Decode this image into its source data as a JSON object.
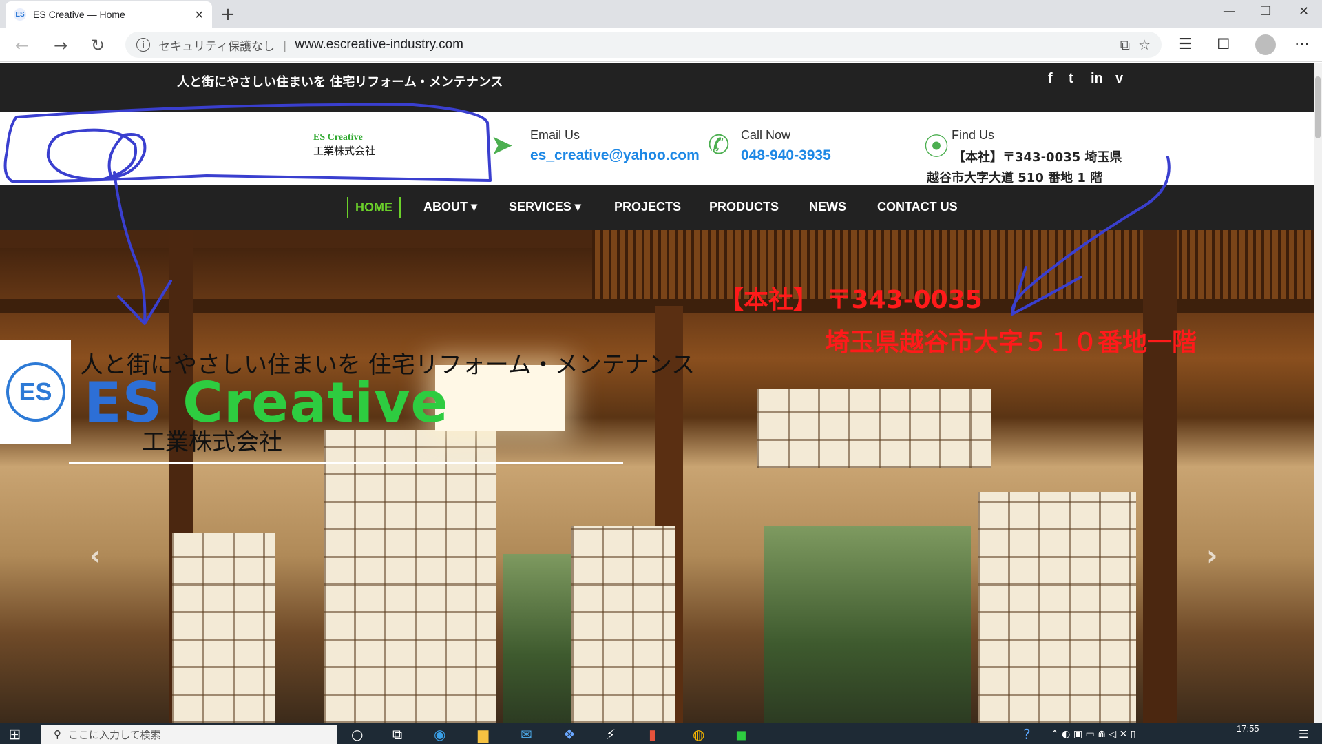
{
  "browser": {
    "tab_title": "ES Creative — Home",
    "tab_favicon": "ES",
    "security_label": "セキュリティ保護なし",
    "url": "www.escreative-industry.com"
  },
  "topbar": {
    "tagline": "人と街にやさしい住まいを 住宅リフォーム・メンテナンス",
    "social": [
      "f",
      "t",
      "in",
      "v"
    ]
  },
  "header": {
    "logo_line1": "ES Creative",
    "logo_line2": "工業株式会社",
    "email_label": "Email Us",
    "email_value": "es_creative@yahoo.com",
    "call_label": "Call Now",
    "call_value": "048-940-3935",
    "find_label": "Find Us",
    "address_line1": "【本社】〒343-0035 埼玉県",
    "address_line2": "越谷市大字大道 510 番地 1 階"
  },
  "nav": {
    "items": [
      {
        "label": "HOME"
      },
      {
        "label": "ABOUT ▾"
      },
      {
        "label": "SERVICES ▾"
      },
      {
        "label": "PROJECTS"
      },
      {
        "label": "PRODUCTS"
      },
      {
        "label": "NEWS"
      },
      {
        "label": "CONTACT US"
      }
    ]
  },
  "hero": {
    "logo_mark": "ES",
    "tagline": "人と街にやさしい住まいを 住宅リフォーム・メンテナンス",
    "brand_es": "ES",
    "brand_rest": " Creative",
    "company": "工業株式会社",
    "annotation_line1": "【本社】 〒343-0035",
    "annotation_line2": "埼玉県越谷市大字５１０番地一階",
    "prev": "‹",
    "next": "›"
  },
  "taskbar": {
    "search_placeholder": "ここに入力して検索",
    "time": "17:55"
  },
  "colors": {
    "nav_active": "#6bd12a",
    "link_blue": "#1e88e5",
    "annotation_red": "#ff1a1a",
    "annotation_ink": "#3a3fcf"
  }
}
